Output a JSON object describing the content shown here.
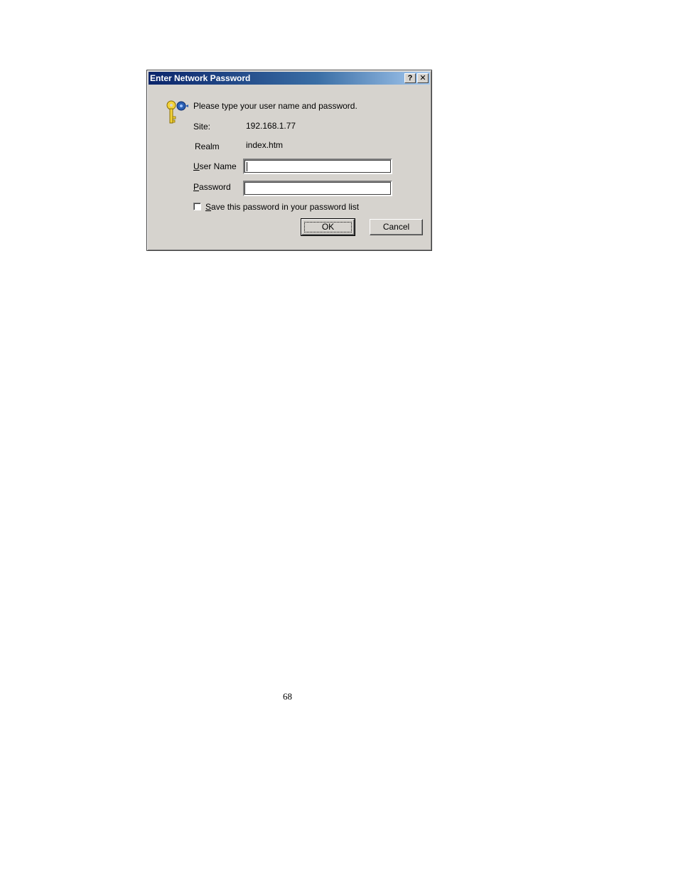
{
  "dialog": {
    "title": "Enter Network Password",
    "help_button": "?",
    "close_button": "✕",
    "prompt": "Please type your user name and password.",
    "site_label": "Site:",
    "site_value": "192.168.1.77",
    "realm_label": "Realm",
    "realm_value": "index.htm",
    "username_label_key": "U",
    "username_label_rest": "ser Name",
    "username_value": "",
    "password_label_key": "P",
    "password_label_rest": "assword",
    "password_value": "",
    "save_checkbox_checked": false,
    "save_label_key": "S",
    "save_label_rest": "ave this password in your password list",
    "ok_label": "OK",
    "cancel_label": "Cancel",
    "icon": "key-icon"
  },
  "page": {
    "number": "68"
  },
  "colors": {
    "dialog_bg": "#d6d3ce",
    "titlebar_start": "#0a246a",
    "titlebar_end": "#a6caf0"
  }
}
